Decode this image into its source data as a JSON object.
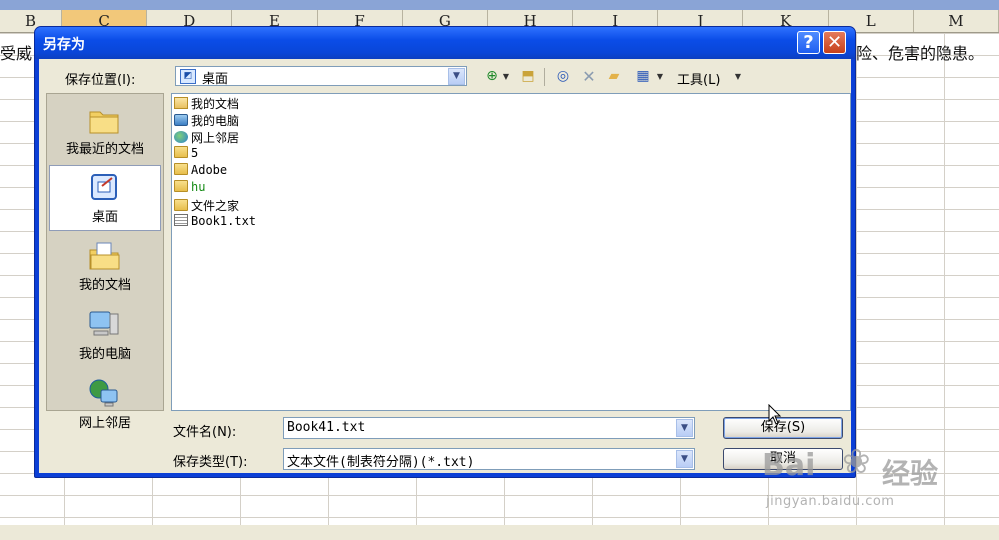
{
  "spreadsheet": {
    "columns": [
      {
        "label": "B",
        "selected": false
      },
      {
        "label": "C",
        "selected": true
      },
      {
        "label": "D",
        "selected": false
      },
      {
        "label": "E",
        "selected": false
      },
      {
        "label": "F",
        "selected": false
      },
      {
        "label": "G",
        "selected": false
      },
      {
        "label": "H",
        "selected": false
      },
      {
        "label": "I",
        "selected": false
      },
      {
        "label": "J",
        "selected": false
      },
      {
        "label": "K",
        "selected": false
      },
      {
        "label": "L",
        "selected": false
      },
      {
        "label": "M",
        "selected": false
      }
    ],
    "cell_text_left": "受威",
    "cell_text_right": "险、危害的隐患。"
  },
  "dialog": {
    "title": "另存为",
    "help_glyph": "?",
    "close_glyph": "✕",
    "save_in_label": "保存位置(I):",
    "save_in_value": "桌面",
    "tools_label": "工具(L)",
    "places": [
      {
        "id": "recent",
        "label": "我最近的文档",
        "icon": "recent-docs-icon",
        "active": false
      },
      {
        "id": "desktop",
        "label": "桌面",
        "icon": "desktop-icon",
        "active": true
      },
      {
        "id": "docs",
        "label": "我的文档",
        "icon": "my-documents-icon",
        "active": false
      },
      {
        "id": "computer",
        "label": "我的电脑",
        "icon": "my-computer-icon",
        "active": false
      },
      {
        "id": "network",
        "label": "网上邻居",
        "icon": "network-places-icon",
        "active": false
      }
    ],
    "files": [
      {
        "name": "我的文档",
        "icon": "docs",
        "cjk": true,
        "green": false
      },
      {
        "name": "我的电脑",
        "icon": "computer",
        "cjk": true,
        "green": false
      },
      {
        "name": "网上邻居",
        "icon": "network",
        "cjk": true,
        "green": false
      },
      {
        "name": "5",
        "icon": "folder",
        "cjk": false,
        "green": false
      },
      {
        "name": "Adobe",
        "icon": "folder",
        "cjk": false,
        "green": false
      },
      {
        "name": "hu",
        "icon": "folder",
        "cjk": false,
        "green": true
      },
      {
        "name": "文件之家",
        "icon": "folder",
        "cjk": true,
        "green": false
      },
      {
        "name": "Book1.txt",
        "icon": "txt",
        "cjk": false,
        "green": false
      }
    ],
    "filename_label": "文件名(N):",
    "filename_value": "Book41.txt",
    "filetype_label": "保存类型(T):",
    "filetype_value": "文本文件(制表符分隔)(*.txt)",
    "save_label": "保存(S)",
    "cancel_label": "取消"
  },
  "watermark": {
    "logo": "Bai",
    "brand": "经验",
    "url": "jingyan.baidu.com"
  }
}
